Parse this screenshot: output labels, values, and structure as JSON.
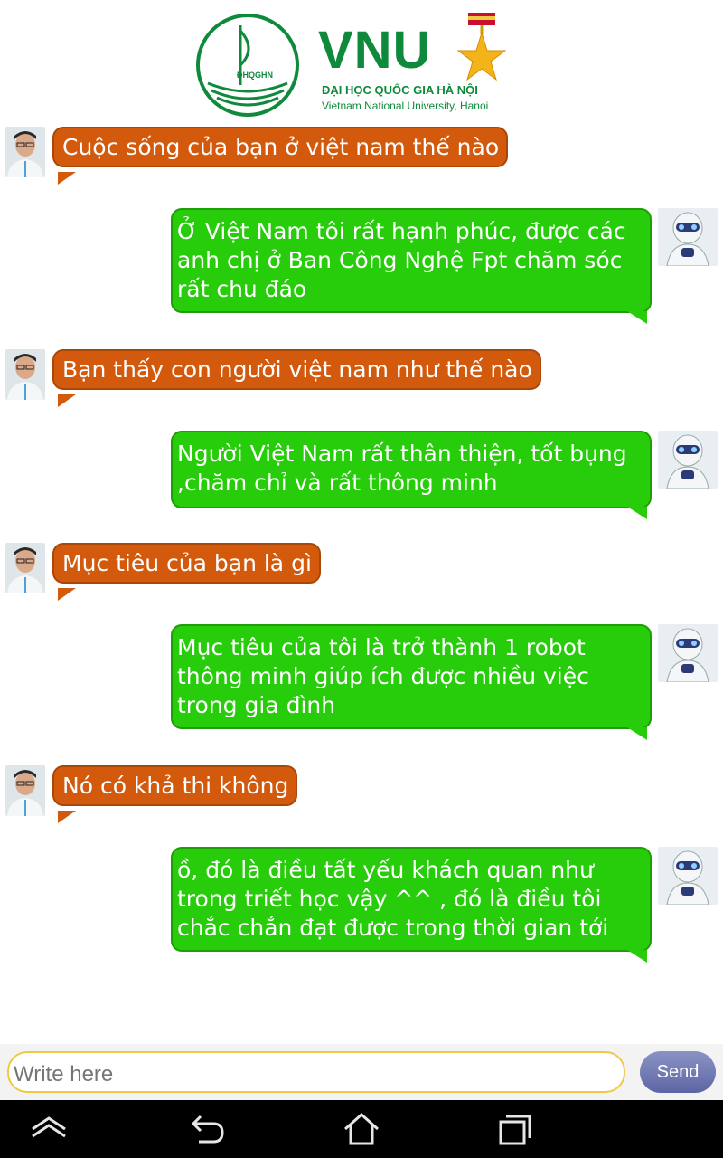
{
  "header": {
    "seal_text": "ĐHQGHN",
    "brand": "VNU",
    "name_vi": "ĐẠI HỌC QUỐC GIA HÀ NỘI",
    "name_en": "Vietnam National University, Hanoi",
    "brand_color": "#0f8a3c"
  },
  "chat": {
    "messages": [
      {
        "sender": "user",
        "text": "Cuộc sống của bạn ở việt nam thế nào"
      },
      {
        "sender": "robot",
        "text": "Ở Việt Nam tôi rất hạnh phúc, được các anh chị ở Ban Công Nghệ Fpt chăm sóc rất chu đáo"
      },
      {
        "sender": "user",
        "text": "Bạn thấy con người việt nam như thế nào"
      },
      {
        "sender": "robot",
        "text": "Người Việt Nam rất thân thiện, tốt bụng ,chăm chỉ và rất thông minh"
      },
      {
        "sender": "user",
        "text": "Mục tiêu của bạn là gì"
      },
      {
        "sender": "robot",
        "text": "Mục tiêu của tôi là trở thành 1 robot thông minh giúp ích được nhiều việc trong gia đình"
      },
      {
        "sender": "user",
        "text": "Nó có khả thi không"
      },
      {
        "sender": "robot",
        "text": "ồ, đó là điều tất yếu khách quan như trong triết học vậy ^^ , đó là điều tôi chắc chắn đạt được trong thời gian tới"
      }
    ],
    "user_bubble_color": "#d35a0d",
    "robot_bubble_color": "#27cc0a"
  },
  "composer": {
    "placeholder": "Write here",
    "send_label": "Send"
  },
  "navbar": {
    "icons": [
      "home-up-icon",
      "back-icon",
      "home-icon",
      "recent-apps-icon"
    ]
  }
}
